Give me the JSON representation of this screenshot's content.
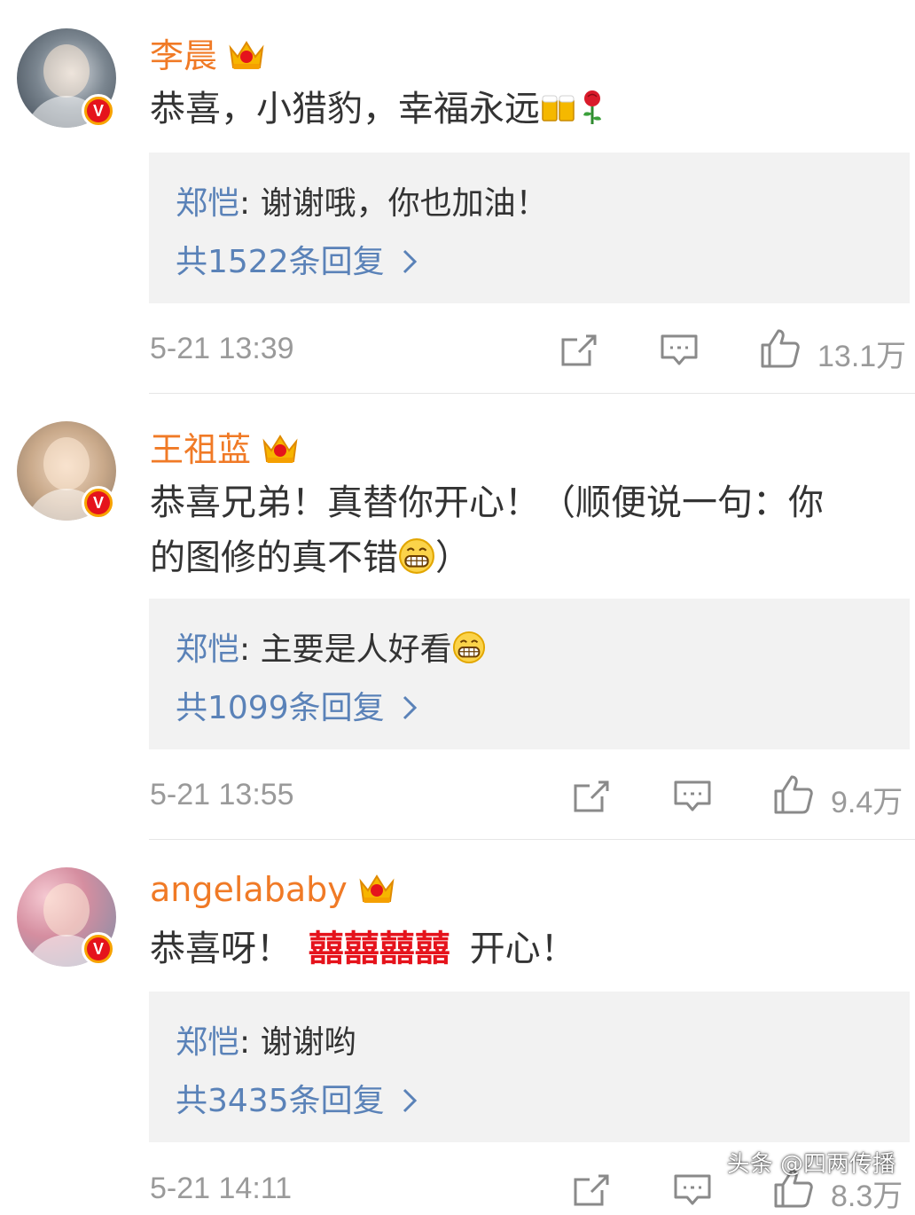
{
  "colors": {
    "username": "#f07a26",
    "reply_author": "#5a82b8",
    "meta": "#9a9a9a",
    "reply_bg": "#f2f2f2",
    "verified_badge": "#f7a300"
  },
  "comments": [
    {
      "username": "李晨",
      "crown_level": "7",
      "text": "恭喜，小猎豹，幸福永远",
      "emojis": [
        "beer-emoji",
        "rose-emoji"
      ],
      "reply": {
        "author": "郑恺",
        "separator": ": ",
        "text": "谢谢哦，你也加油！"
      },
      "reply_count": "共1522条回复",
      "time": "5-21 13:39",
      "likes": "13.1万"
    },
    {
      "username": "王祖蓝",
      "crown_level": "6",
      "text_line1": "恭喜兄弟！真替你开心！（顺便说一句：你",
      "text_line2": "的图修的真不错",
      "text_line2_end": "）",
      "reply": {
        "author": "郑恺",
        "separator": ": ",
        "text": "主要是人好看"
      },
      "reply_count": "共1099条回复",
      "time": "5-21 13:55",
      "likes": "9.4万"
    },
    {
      "username": "angelababy",
      "crown_level": "7",
      "text": "恭喜呀！",
      "double_happiness": [
        "囍",
        "囍",
        "囍",
        "囍"
      ],
      "text_end": "开心！",
      "reply": {
        "author": "郑恺",
        "separator": ": ",
        "text": "谢谢哟"
      },
      "reply_count": "共3435条回复",
      "time": "5-21 14:11",
      "likes": "8.3万"
    }
  ],
  "icons": [
    "verified-v-icon",
    "crown-icon",
    "repost-icon",
    "comment-icon",
    "like-icon",
    "chevron-right-icon"
  ],
  "watermark": "头条 @四两传播"
}
